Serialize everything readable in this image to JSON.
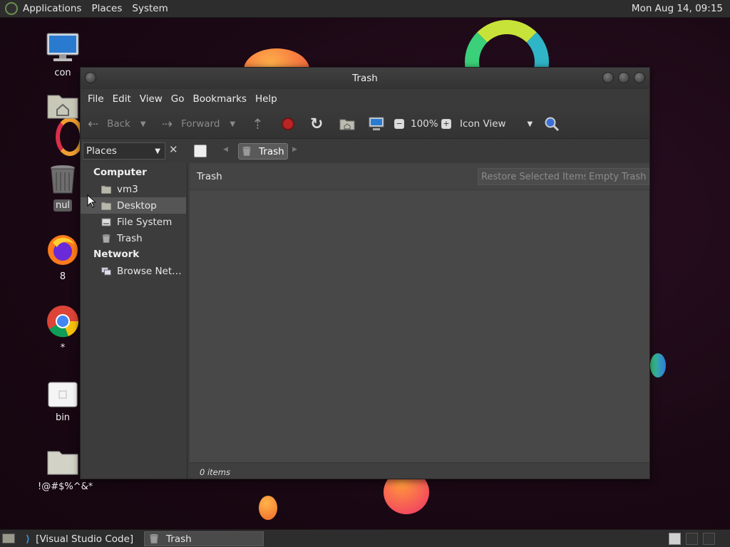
{
  "topbar": {
    "menus": [
      "Applications",
      "Places",
      "System"
    ],
    "clock": "Mon Aug 14, 09:15"
  },
  "desktop_icons": [
    {
      "label": "con",
      "icon": "computer-icon"
    },
    {
      "label": "",
      "icon": "home-folder-icon"
    },
    {
      "label": "nul",
      "icon": "trash-icon"
    },
    {
      "label": "8",
      "icon": "firefox-icon"
    },
    {
      "label": "*",
      "icon": "chrome-icon"
    },
    {
      "label": "bin",
      "icon": "file-icon"
    },
    {
      "label": "!@#$%^&*",
      "icon": "folder-icon"
    }
  ],
  "window": {
    "title": "Trash",
    "menubar": [
      "File",
      "Edit",
      "View",
      "Go",
      "Bookmarks",
      "Help"
    ],
    "toolbar": {
      "back": "Back",
      "forward": "Forward",
      "zoom": "100%",
      "view_mode": "Icon View"
    },
    "pathbar": {
      "crumb": "Trash"
    },
    "sidebar": {
      "selector": "Places",
      "sections": [
        {
          "title": "Computer",
          "items": [
            "vm3",
            "Desktop",
            "File System",
            "Trash"
          ]
        },
        {
          "title": "Network",
          "items": [
            "Browse Net…"
          ]
        }
      ],
      "selected": "Desktop"
    },
    "trash_header": {
      "title": "Trash",
      "restore_button": "Restore Selected Items",
      "empty_button": "Empty Trash"
    },
    "status": "0 items"
  },
  "taskbar": {
    "tasks": [
      "[Visual Studio Code]",
      "Trash"
    ]
  },
  "colors": {
    "accent": "#3a6fd8",
    "stop_red": "#b92424",
    "desktop_bg": "#1a0814"
  }
}
